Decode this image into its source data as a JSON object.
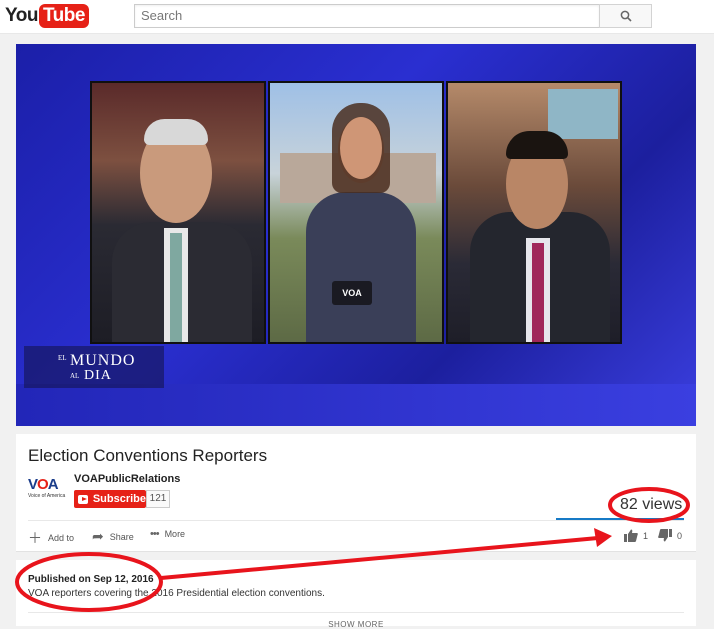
{
  "logo": {
    "part1": "You",
    "part2": "Tube"
  },
  "search": {
    "placeholder": "Search"
  },
  "player": {
    "overlay_el": "EL",
    "overlay_mundo": "MUNDO",
    "overlay_al": "AL",
    "overlay_dia": "DIA",
    "mic_flag": "VOA"
  },
  "video": {
    "title": "Election Conventions Reporters",
    "channel": "VOAPublicRelations",
    "channel_logo_text": "VOA",
    "channel_logo_sub": "Voice of America",
    "subscribe_label": "Subscribe",
    "subscriber_count": "121",
    "views": "82 views"
  },
  "actions": {
    "add_to": "Add to",
    "share": "Share",
    "more": "More",
    "likes": "1",
    "dislikes": "0"
  },
  "description": {
    "published": "Published on Sep 12, 2016",
    "text": "VOA reporters covering the 2016 Presidential election conventions.",
    "show_more": "SHOW MORE"
  },
  "colors": {
    "brand_red": "#e62117",
    "annotation_red": "#e8141c",
    "player_blue": "#2a2fd1"
  }
}
